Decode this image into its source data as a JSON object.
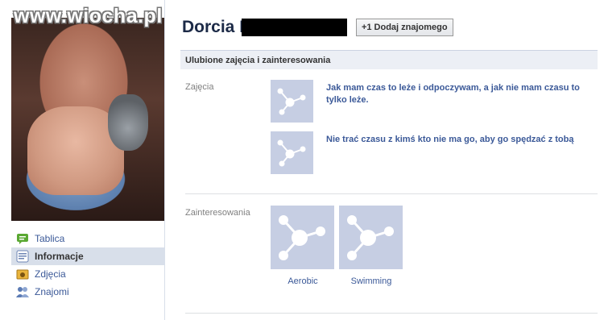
{
  "watermark": "www.wiocha.pl",
  "profile": {
    "name": "Dorcia K",
    "add_friend_label": "Dodaj znajomego",
    "add_friend_prefix": "+1"
  },
  "leftnav": {
    "items": [
      {
        "label": "Tablica",
        "icon": "wall-icon",
        "active": false
      },
      {
        "label": "Informacje",
        "icon": "info-icon",
        "active": true
      },
      {
        "label": "Zdjęcia",
        "icon": "photos-icon",
        "active": false
      },
      {
        "label": "Znajomi",
        "icon": "friends-icon",
        "active": false
      }
    ]
  },
  "section": {
    "title": "Ulubione zajęcia i zainteresowania",
    "activities_label": "Zajęcia",
    "activities": [
      {
        "text": "Jak mam czas to leże i odpoczywam, a jak nie mam czasu to tylko leże."
      },
      {
        "text": "Nie trać czasu z kimś kto nie ma go, aby go spędzać z tobą"
      }
    ],
    "interests_label": "Zainteresowania",
    "interests": [
      {
        "label": "Aerobic"
      },
      {
        "label": "Swimming"
      }
    ]
  },
  "colors": {
    "link": "#3b5998",
    "placeholder": "#c6cee3",
    "section_bg": "#eceff5"
  }
}
